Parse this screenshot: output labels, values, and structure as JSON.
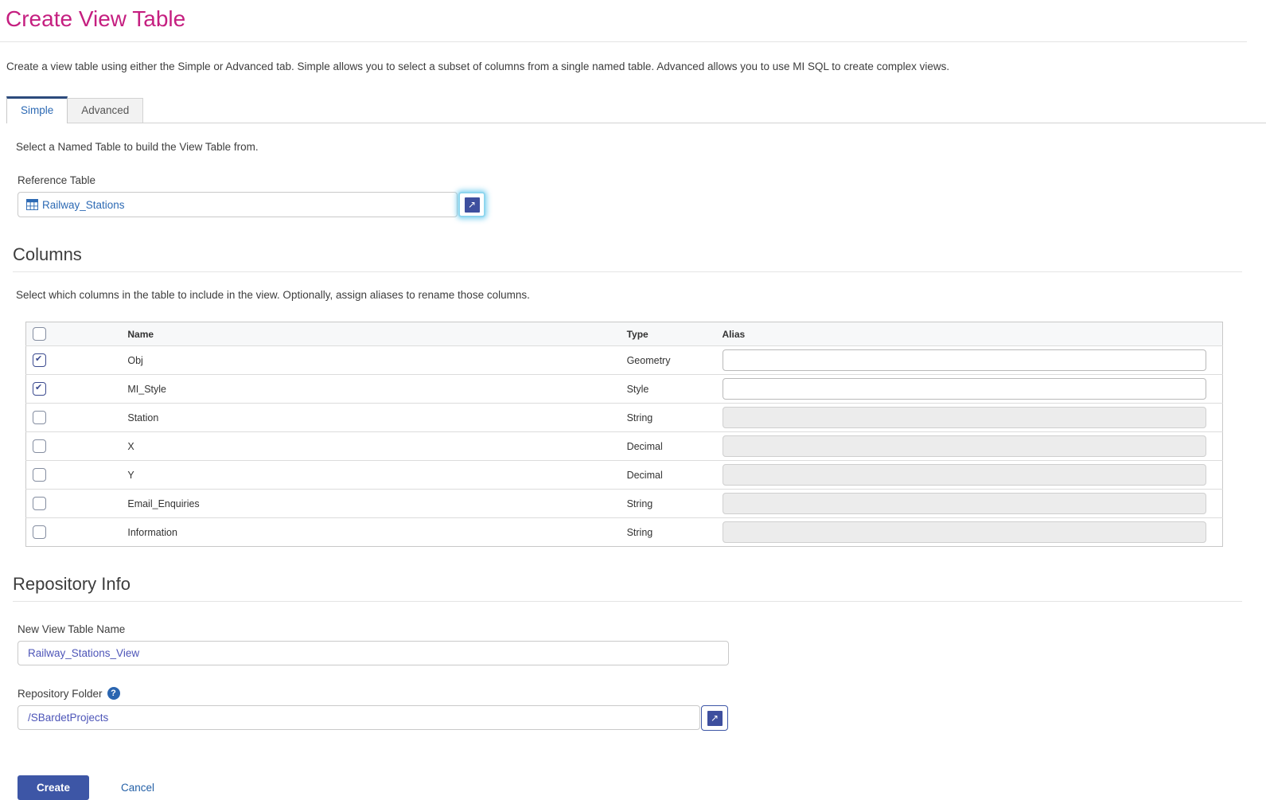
{
  "page": {
    "title": "Create View Table",
    "description": "Create a view table using either the Simple or Advanced tab. Simple allows you to select a subset of columns from a single named table. Advanced allows you to use MI SQL to create complex views."
  },
  "tabs": {
    "simple_label": "Simple",
    "advanced_label": "Advanced",
    "active": "Simple"
  },
  "simple_tab": {
    "instruction": "Select a Named Table to build the View Table from.",
    "reference_table": {
      "label": "Reference Table",
      "value": "Railway_Stations",
      "icon": "table-grid-icon",
      "browse_icon": "open-picker-ne-arrow-icon"
    }
  },
  "columns_section": {
    "heading": "Columns",
    "description": "Select which columns in the table to include in the view. Optionally, assign aliases to rename those columns.",
    "table": {
      "headers": {
        "name": "Name",
        "type": "Type",
        "alias": "Alias"
      },
      "rows": [
        {
          "checked": true,
          "name": "Obj",
          "type": "Geometry",
          "alias": "",
          "alias_enabled": true
        },
        {
          "checked": true,
          "name": "MI_Style",
          "type": "Style",
          "alias": "",
          "alias_enabled": true
        },
        {
          "checked": false,
          "name": "Station",
          "type": "String",
          "alias": "",
          "alias_enabled": false
        },
        {
          "checked": false,
          "name": "X",
          "type": "Decimal",
          "alias": "",
          "alias_enabled": false
        },
        {
          "checked": false,
          "name": "Y",
          "type": "Decimal",
          "alias": "",
          "alias_enabled": false
        },
        {
          "checked": false,
          "name": "Email_Enquiries",
          "type": "String",
          "alias": "",
          "alias_enabled": false
        },
        {
          "checked": false,
          "name": "Information",
          "type": "String",
          "alias": "",
          "alias_enabled": false
        }
      ]
    }
  },
  "repository_section": {
    "heading": "Repository Info",
    "new_view_table_name": {
      "label": "New View Table Name",
      "value": "Railway_Stations_View"
    },
    "repository_folder": {
      "label": "Repository Folder",
      "help_icon": "?",
      "value": "/SBardetProjects",
      "browse_icon": "open-picker-ne-arrow-icon"
    }
  },
  "actions": {
    "create_label": "Create",
    "cancel_label": "Cancel"
  },
  "colors": {
    "title": "#c51f80",
    "link_blue": "#2d6ab4",
    "button_indigo": "#3d56a6",
    "icon_indigo": "#3e4f9e",
    "active_tab_border": "#2c4a7c"
  }
}
